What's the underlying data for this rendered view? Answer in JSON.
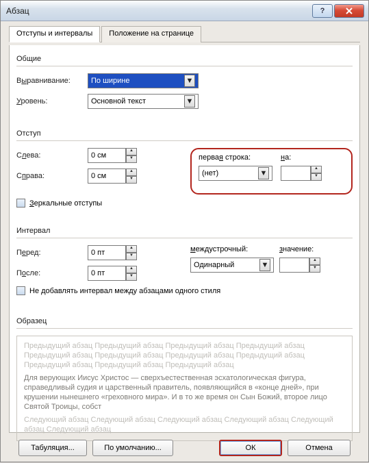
{
  "title": "Абзац",
  "tabs": {
    "tab1": "Отступы и интервалы",
    "tab2": "Положение на странице"
  },
  "group_general": "Общие",
  "alignment": {
    "label_pre": "В",
    "label_u": "ы",
    "label_post": "равнивание:",
    "value": "По ширине"
  },
  "level": {
    "label_u": "У",
    "label_post": "ровень:",
    "value": "Основной текст"
  },
  "group_indent": "Отступ",
  "left": {
    "label_pre": "С",
    "label_u": "л",
    "label_post": "ева:",
    "value": "0 см"
  },
  "right": {
    "label_pre": "С",
    "label_u": "п",
    "label_post": "рава:",
    "value": "0 см"
  },
  "first_line": {
    "label_pre": "перва",
    "label_u": "я",
    "label_post": " строка:",
    "on_label_u": "н",
    "on_label_post": "а:",
    "value": "(нет)",
    "on_value": ""
  },
  "mirror": {
    "label_pre": "",
    "label_u": "З",
    "label_post": "еркальные отступы"
  },
  "group_interval": "Интервал",
  "before": {
    "label_pre": "П",
    "label_u": "е",
    "label_post": "ред:",
    "value": "0 пт"
  },
  "after": {
    "label_pre": "П",
    "label_u": "о",
    "label_post": "сле:",
    "value": "0 пт"
  },
  "line_spacing": {
    "label_u": "м",
    "label_post": "еждустрочный:",
    "val_label_u": "з",
    "val_label_post": "начение:",
    "value": "Одинарный",
    "val_value": ""
  },
  "no_add": {
    "label": "Не добавлять интервал между абзацами одного стиля"
  },
  "group_sample": "Образец",
  "sample_prev": "Предыдущий абзац Предыдущий абзац Предыдущий абзац Предыдущий абзац Предыдущий абзац Предыдущий абзац Предыдущий абзац Предыдущий абзац Предыдущий абзац Предыдущий абзац Предыдущий абзац",
  "sample_text": "Для верующих Иисус Христос — сверхъестественная эсхатологическая фигура, справедливый судия и царственный правитель, появляющийся в «конце дней», при крушении нынешнего «греховного мира». И в то же время он Сын Божий, второе лицо Святой Троицы, собст",
  "sample_next": "Следующий абзац Следующий абзац Следующий абзац Следующий абзац Следующий абзац Следующий абзац",
  "buttons": {
    "tabulation": "Табуляция...",
    "default": "По умолчанию...",
    "ok": "ОК",
    "cancel": "Отмена"
  }
}
